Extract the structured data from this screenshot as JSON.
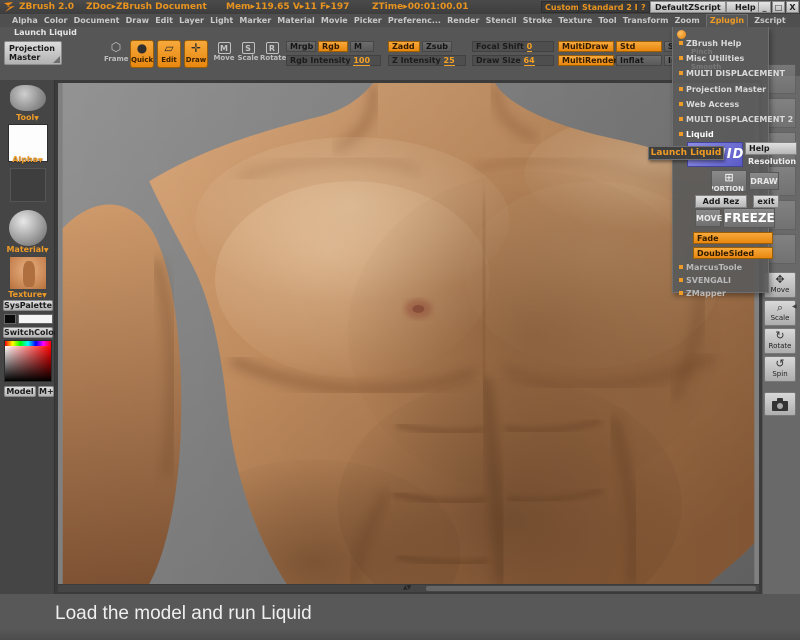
{
  "title_bar": {
    "app_name": "ZBrush 2.0",
    "doc_info": "ZDoc▸ZBrush Document",
    "mem_info": "Mem▸119.65  V▸11  F▸197",
    "time_info": "ZTime▸00:01:00.01",
    "custom": "Custom",
    "standard": "Standard 2 D",
    "quick_help": "?",
    "default_zscript": "DefaultZScript",
    "help": "Help",
    "minimize": "_",
    "restore": "□",
    "close": "X"
  },
  "menu_bar": {
    "items": [
      "Alpha",
      "Color",
      "Document",
      "Draw",
      "Edit",
      "Layer",
      "Light",
      "Marker",
      "Material",
      "Movie",
      "Picker",
      "Preferenc...",
      "Render",
      "Stencil",
      "Stroke",
      "Texture",
      "Tool",
      "Transform",
      "Zoom",
      "Zplugin",
      "Zscript"
    ]
  },
  "toolbar": {
    "launch_liquid_label": "Launch Liquid",
    "projection_master_line1": "Projection",
    "projection_master_line2": "Master",
    "frame": "Frame",
    "quick": "Quick",
    "edit": "Edit",
    "draw": "Draw",
    "move": "Move",
    "scale": "Scale",
    "rotate": "Rotate",
    "move_letter": "M",
    "scale_letter": "S",
    "rotate_letter": "R",
    "mrgb": "Mrgb",
    "rgb": "Rgb",
    "m": "M",
    "rgb_intensity_label": "Rgb Intensity",
    "rgb_intensity_value": "100",
    "zadd": "Zadd",
    "zsub": "Zsub",
    "z_intensity_label": "Z Intensity",
    "z_intensity_value": "25",
    "focal_shift_label": "Focal Shift",
    "focal_shift_value": "0",
    "draw_size_label": "Draw Size",
    "draw_size_value": "64",
    "multidraw": "MultiDraw",
    "multirender": "MultiRender",
    "std": "Std",
    "inflat": "Inflat",
    "stddot": "StdDot",
    "inflatdot": "InflatD"
  },
  "sidebar": {
    "tool_label": "Tool",
    "alpha_label": "Alpha",
    "material_label": "Material",
    "texture_label": "Texture",
    "arrow": "▼",
    "syspalette": "SysPalette",
    "switchcolor": "SwitchColor",
    "model": "Model",
    "m_plus": "M+"
  },
  "right_toolbar": {
    "move": "Move",
    "scale": "Scale",
    "rotate": "Rotate",
    "spin": "Spin"
  },
  "zplugin_menu": {
    "items": [
      "ZBrush Help",
      "Misc Utilities",
      "MULTI DISPLACEMENT",
      "Projection Master",
      "Web Access",
      "MULTI DISPLACEMENT 2",
      "Liquid"
    ],
    "ghosts": [
      "Pinch",
      "Smooth"
    ],
    "extra_items": [
      "MarcusToole",
      "SVENGALI",
      "ZMapper"
    ],
    "liquid": {
      "logo": "LIQUID",
      "help": "Help",
      "resolution": "Resolution",
      "proportion": "PROPORTION",
      "proportion_icon": "⊞",
      "draw": "DRAW",
      "add_rez": "Add Rez",
      "exit": "exit",
      "move": "MOVE",
      "freeze": "FREEZE",
      "fade": "Fade",
      "doublesided": "DoubleSided"
    }
  },
  "tooltip": {
    "text": "Launch Liquid"
  },
  "statusbar": {
    "caption": "Load the model and run Liquid"
  },
  "scroll": {
    "up": "▲",
    "down": "▼",
    "left_arrow": "◀"
  },
  "colors": {
    "accent": "#ef9b28",
    "orange_button": "#f0941e",
    "liquid_blue": "#6a6ad0"
  }
}
